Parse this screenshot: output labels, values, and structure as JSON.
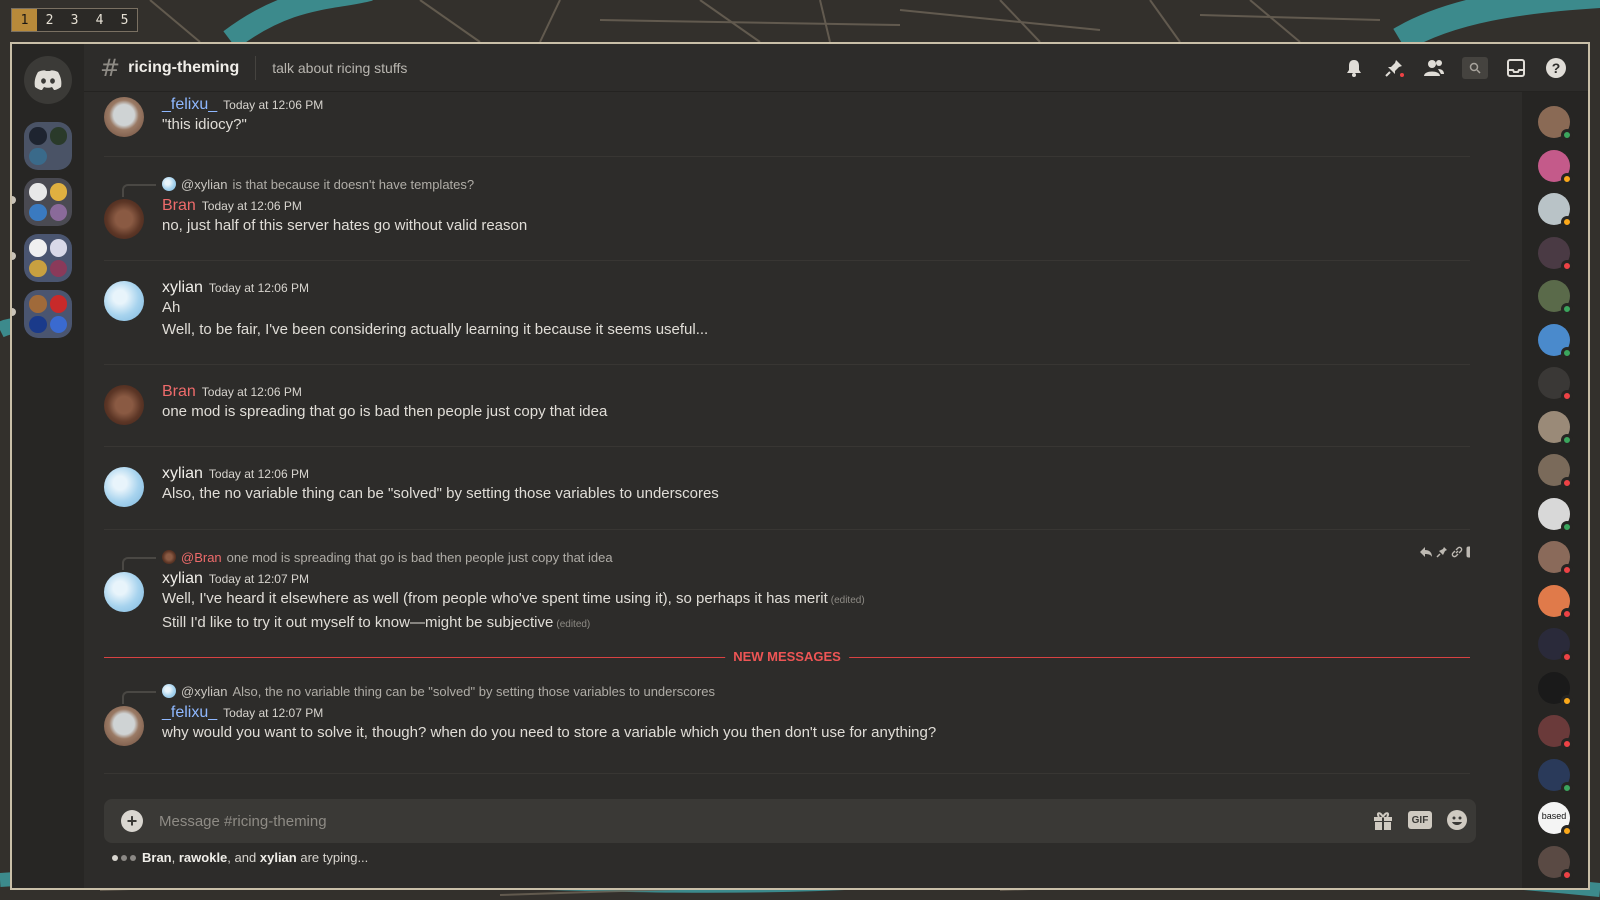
{
  "workspaces": [
    "1",
    "2",
    "3",
    "4",
    "5"
  ],
  "active_workspace": "1",
  "channel": {
    "name": "ricing-theming",
    "topic": "talk about ricing stuffs"
  },
  "messages": [
    {
      "author": "_felixu_",
      "avatar": "felix",
      "author_color": "#8fb8ff",
      "timestamp": "Today at 12:06 PM",
      "lines": [
        "\"this idiocy?\""
      ]
    },
    {
      "reply": {
        "avatar": "xylian",
        "mention": "@xylian",
        "text": "is that because it doesn't have templates?"
      },
      "author": "Bran",
      "avatar": "bran",
      "timestamp": "Today at 12:06 PM",
      "lines": [
        "no, just half of this server hates go without valid reason"
      ]
    },
    {
      "author": "xylian",
      "avatar": "xylian",
      "timestamp": "Today at 12:06 PM",
      "lines": [
        "Ah",
        "Well, to be fair, I've been considering actually learning it because it seems useful..."
      ]
    },
    {
      "author": "Bran",
      "avatar": "bran",
      "timestamp": "Today at 12:06 PM",
      "lines": [
        "one mod is spreading that go is bad then people just copy that idea"
      ]
    },
    {
      "author": "xylian",
      "avatar": "xylian",
      "timestamp": "Today at 12:06 PM",
      "lines": [
        "Also, the no variable thing can be \"solved\" by setting those variables to underscores"
      ]
    },
    {
      "reply": {
        "avatar": "bran",
        "mention": "@Bran",
        "text": "one mod is spreading that go is bad then people just copy that idea"
      },
      "author": "xylian",
      "avatar": "xylian",
      "timestamp": "Today at 12:07 PM",
      "lines": [
        "Well, I've heard it elsewhere as well (from people who've spent time using it), so perhaps it has merit",
        "Still I'd like to try it out myself to know—might be subjective"
      ],
      "edited_label": "(edited)",
      "hovered": true
    },
    {
      "reply": {
        "avatar": "xylian",
        "mention": "@xylian",
        "text": "Also, the no variable thing can be \"solved\" by setting those variables to underscores"
      },
      "author": "_felixu_",
      "avatar": "felix",
      "timestamp": "Today at 12:07 PM",
      "lines": [
        "why would you want to solve it, though? when do you need to store a variable which you then don't use for anything?"
      ]
    }
  ],
  "new_messages_label": "NEW MESSAGES",
  "composer": {
    "placeholder": "Message #ricing-theming",
    "gif_label": "GIF"
  },
  "typing": {
    "users": [
      "Bran",
      "rawokle",
      "xylian"
    ],
    "sep1": ",",
    "and": "and",
    "suffix": "are typing..."
  },
  "members": [
    {
      "status": "online",
      "color": "#8a6a55"
    },
    {
      "status": "idle",
      "color": "#c45a8a"
    },
    {
      "status": "idle",
      "color": "#b9c3c7"
    },
    {
      "status": "dnd",
      "color": "#4a3a44"
    },
    {
      "status": "online",
      "color": "#5a6a4a"
    },
    {
      "status": "online",
      "color": "#4a8acc"
    },
    {
      "status": "dnd",
      "color": "#3a3836"
    },
    {
      "status": "online",
      "color": "#9a8a78"
    },
    {
      "status": "dnd",
      "color": "#7a6a5a"
    },
    {
      "status": "online",
      "color": "#d8d8d8"
    },
    {
      "status": "dnd",
      "color": "#8a6a5a"
    },
    {
      "status": "dnd",
      "color": "#e07a4a"
    },
    {
      "status": "dnd",
      "color": "#2a2a3a"
    },
    {
      "status": "idle",
      "color": "#1a1a1a"
    },
    {
      "status": "dnd",
      "color": "#6a3a3a"
    },
    {
      "status": "online",
      "color": "#2a3a5a"
    },
    {
      "status": "idle",
      "color": "#f4f4f4",
      "label": "based"
    },
    {
      "status": "dnd",
      "color": "#5a4a44"
    }
  ]
}
